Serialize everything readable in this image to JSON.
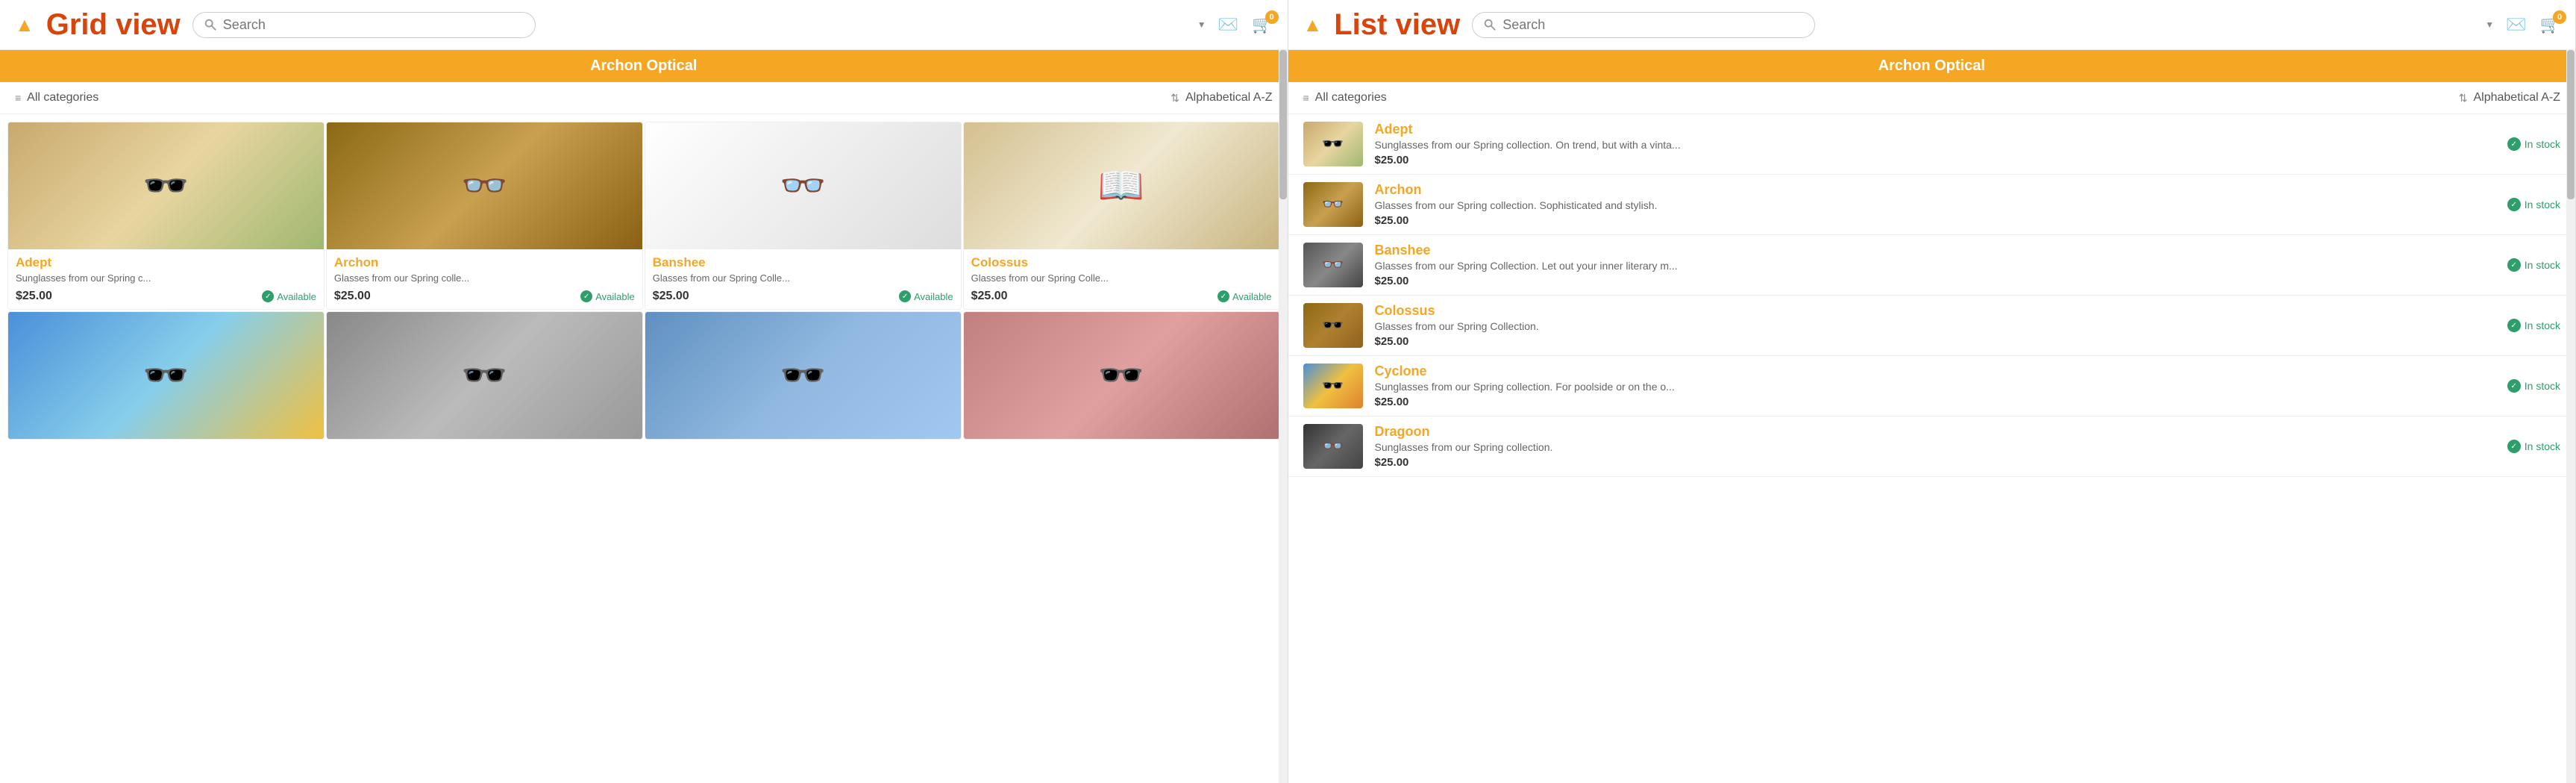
{
  "grid": {
    "title": "Grid view",
    "logo_symbol": "▲",
    "search_placeholder": "Search",
    "store_name": "Archon Optical",
    "all_categories": "All categories",
    "sort_label": "Alphabetical A-Z",
    "badge_count": "0",
    "products_row1": [
      {
        "id": "adept",
        "name": "Adept",
        "desc": "Sunglasses from our Spring c...",
        "price": "$25.00",
        "status": "Available",
        "img_class": "img-adept"
      },
      {
        "id": "archon",
        "name": "Archon",
        "desc": "Glasses from our Spring colle...",
        "price": "$25.00",
        "status": "Available",
        "img_class": "img-archon"
      },
      {
        "id": "banshee",
        "name": "Banshee",
        "desc": "Glasses from our Spring Colle...",
        "price": "$25.00",
        "status": "Available",
        "img_class": "img-banshee"
      },
      {
        "id": "colossus",
        "name": "Colossus",
        "desc": "Glasses from our Spring Colle...",
        "price": "$25.00",
        "status": "Available",
        "img_class": "img-colossus"
      }
    ],
    "products_row2": [
      {
        "id": "cyclone",
        "name": "",
        "desc": "",
        "price": "",
        "status": "",
        "img_class": "img-row2-1"
      },
      {
        "id": "dragoon",
        "name": "",
        "desc": "",
        "price": "",
        "status": "",
        "img_class": "img-row2-2"
      },
      {
        "id": "elite",
        "name": "",
        "desc": "",
        "price": "",
        "status": "",
        "img_class": "img-row2-3"
      },
      {
        "id": "falcon",
        "name": "",
        "desc": "",
        "price": "",
        "status": "",
        "img_class": "img-row2-4"
      }
    ]
  },
  "list": {
    "title": "List view",
    "logo_symbol": "▲",
    "search_placeholder": "Search",
    "store_name": "Archon Optical",
    "all_categories": "All categories",
    "sort_label": "Alphabetical A-Z",
    "badge_count": "0",
    "products": [
      {
        "id": "adept",
        "name": "Adept",
        "desc": "Sunglasses from our Spring collection. On trend, but with a vinta...",
        "price": "$25.00",
        "status": "In stock",
        "img_class": "list-img-adept"
      },
      {
        "id": "archon",
        "name": "Archon",
        "desc": "Glasses from our Spring collection. Sophisticated and stylish.",
        "price": "$25.00",
        "status": "In stock",
        "img_class": "list-img-archon"
      },
      {
        "id": "banshee",
        "name": "Banshee",
        "desc": "Glasses from our Spring Collection. Let out your inner literary m...",
        "price": "$25.00",
        "status": "In stock",
        "img_class": "list-img-banshee"
      },
      {
        "id": "colossus",
        "name": "Colossus",
        "desc": "Glasses from our Spring Collection.",
        "price": "$25.00",
        "status": "In stock",
        "img_class": "list-img-colossus"
      },
      {
        "id": "cyclone",
        "name": "Cyclone",
        "desc": "Sunglasses from our Spring collection. For poolside or on the o...",
        "price": "$25.00",
        "status": "In stock",
        "img_class": "list-img-cyclone"
      },
      {
        "id": "dragoon",
        "name": "Dragoon",
        "desc": "Sunglasses from our Spring collection.",
        "price": "$25.00",
        "status": "In stock",
        "img_class": "list-img-dragoon"
      }
    ]
  }
}
